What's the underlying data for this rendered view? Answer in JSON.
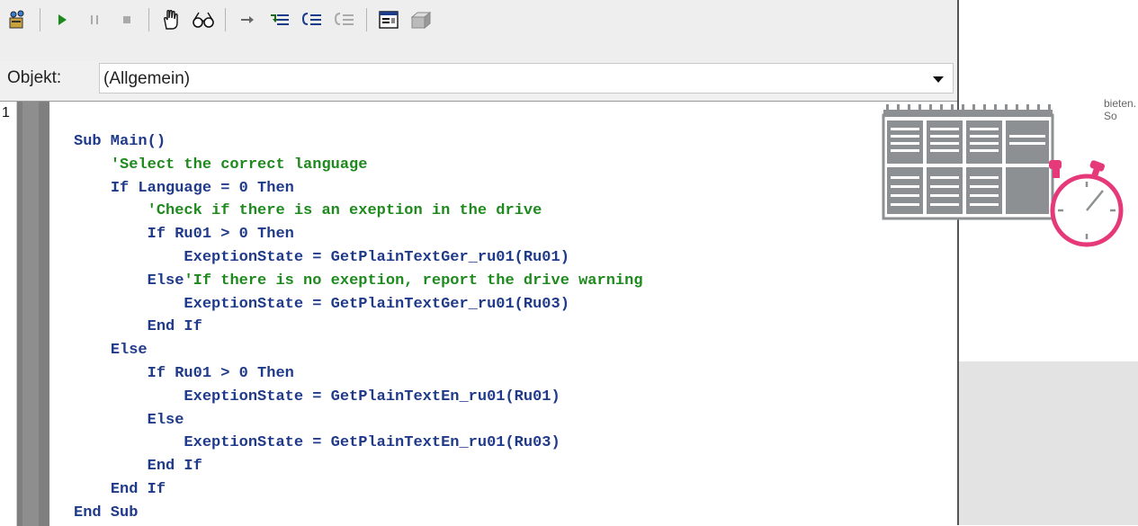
{
  "toolbar": {
    "icons": [
      "project-icon",
      "run-icon",
      "pause-icon",
      "stop-icon",
      "hand-icon",
      "watch-glasses-icon",
      "step-arrow-icon",
      "step-into-icon",
      "step-over-icon",
      "step-out-icon",
      "userform-icon",
      "toolbox-icon"
    ]
  },
  "object_row": {
    "label": "Objekt:",
    "selected": "(Allgemein)"
  },
  "editor": {
    "line_number": "1",
    "lines": [
      {
        "indent": "",
        "code": "Sub Main()",
        "comment": ""
      },
      {
        "indent": "    ",
        "code": "",
        "comment": "'Select the correct language"
      },
      {
        "indent": "    ",
        "code": "If Language = 0 Then",
        "comment": ""
      },
      {
        "indent": "        ",
        "code": "",
        "comment": "'Check if there is an exeption in the drive"
      },
      {
        "indent": "        ",
        "code": "If Ru01 > 0 Then",
        "comment": ""
      },
      {
        "indent": "            ",
        "code": "ExeptionState = GetPlainTextGer_ru01(Ru01)",
        "comment": ""
      },
      {
        "indent": "        ",
        "code": "Else",
        "comment": "'If there is no exeption, report the drive warning"
      },
      {
        "indent": "            ",
        "code": "ExeptionState = GetPlainTextGer_ru01(Ru03)",
        "comment": ""
      },
      {
        "indent": "        ",
        "code": "End If",
        "comment": ""
      },
      {
        "indent": "    ",
        "code": "Else",
        "comment": ""
      },
      {
        "indent": "        ",
        "code": "If Ru01 > 0 Then",
        "comment": ""
      },
      {
        "indent": "            ",
        "code": "ExeptionState = GetPlainTextEn_ru01(Ru01)",
        "comment": ""
      },
      {
        "indent": "        ",
        "code": "Else",
        "comment": ""
      },
      {
        "indent": "            ",
        "code": "ExeptionState = GetPlainTextEn_ru01(Ru03)",
        "comment": ""
      },
      {
        "indent": "        ",
        "code": "End If",
        "comment": ""
      },
      {
        "indent": "    ",
        "code": "End If",
        "comment": ""
      },
      {
        "indent": "",
        "code": "End Sub",
        "comment": ""
      }
    ]
  },
  "graphic": {
    "caption": "bieten. So",
    "icons": [
      "calendar-icon",
      "stopwatch-icon"
    ],
    "colors": {
      "calendar": "#8d9092",
      "stopwatch": "#e5397a"
    }
  },
  "colors": {
    "keyword": "#1f3a8a",
    "comment": "#1e8a1e",
    "margin": "#7f7f7f",
    "background_grey": "#e3e3e4"
  }
}
